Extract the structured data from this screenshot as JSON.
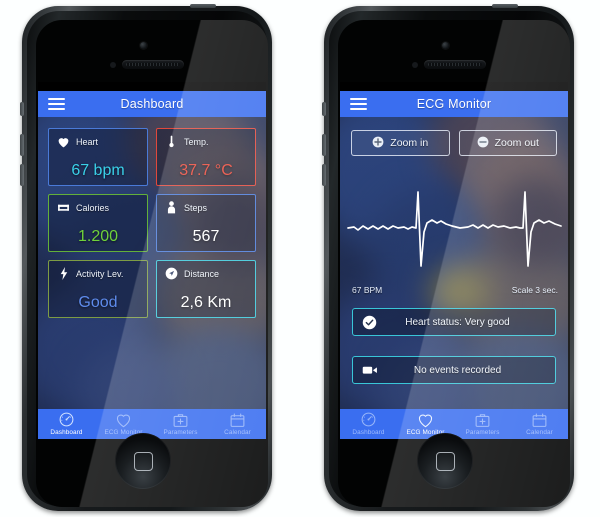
{
  "app": {
    "accent_blue": "#3a6ef0",
    "cyan": "#39c6d8",
    "background": "#fdffff"
  },
  "phones": [
    {
      "id": "phone-dashboard",
      "titlebar": {
        "menu_icon": "hamburger-icon",
        "title": "Dashboard"
      },
      "cards": [
        {
          "name": "Heart",
          "icon": "heart-icon",
          "value": "67 bpm",
          "border": "#4a7ad8",
          "value_color": "#3ad0e8"
        },
        {
          "name": "Temp.",
          "icon": "thermometer-icon",
          "value": "37.7 °C",
          "border": "#e0483c",
          "value_color": "#e8483a"
        },
        {
          "name": "Calories",
          "icon": "cart-icon",
          "value": "1.200",
          "border": "#63b03a",
          "value_color": "#6fd13b"
        },
        {
          "name": "Steps",
          "icon": "person-icon",
          "value": "567",
          "border": "#4a7ad8",
          "value_color": "#ffffff"
        },
        {
          "name": "Activity Lev.",
          "icon": "bolt-icon",
          "value": "Good",
          "border": "#7d9c44",
          "value_color": "#5e8bec"
        },
        {
          "name": "Distance",
          "icon": "navigation-icon",
          "value": "2,6 Km",
          "border": "#39c6d8",
          "value_color": "#ffffff"
        }
      ],
      "tabs": [
        {
          "label": "Dashboard",
          "icon": "speedometer-icon",
          "active": true
        },
        {
          "label": "ECG Monitor",
          "icon": "heart-outline-icon",
          "active": false
        },
        {
          "label": "Parameters",
          "icon": "medkit-icon",
          "active": false
        },
        {
          "label": "Calendar",
          "icon": "calendar-icon",
          "active": false
        }
      ]
    },
    {
      "id": "phone-ecg",
      "titlebar": {
        "menu_icon": "hamburger-icon",
        "title": "ECG Monitor"
      },
      "buttons": [
        {
          "label": "Zoom in",
          "icon": "plus-circle-icon"
        },
        {
          "label": "Zoom out",
          "icon": "minus-circle-icon"
        }
      ],
      "graph": {
        "bpm_label": "67 BPM",
        "scale_label": "Scale 3 sec.",
        "trace_color": "#ffffff"
      },
      "status_rows": [
        {
          "label": "Heart status: Very good",
          "icon": "check-circle-icon"
        },
        {
          "label": "No events recorded",
          "icon": "video-camera-icon"
        }
      ],
      "tabs": [
        {
          "label": "Dashboard",
          "icon": "speedometer-icon",
          "active": false
        },
        {
          "label": "ECG Monitor",
          "icon": "heart-outline-icon",
          "active": true
        },
        {
          "label": "Parameters",
          "icon": "medkit-icon",
          "active": false
        },
        {
          "label": "Calendar",
          "icon": "calendar-icon",
          "active": false
        }
      ]
    }
  ]
}
